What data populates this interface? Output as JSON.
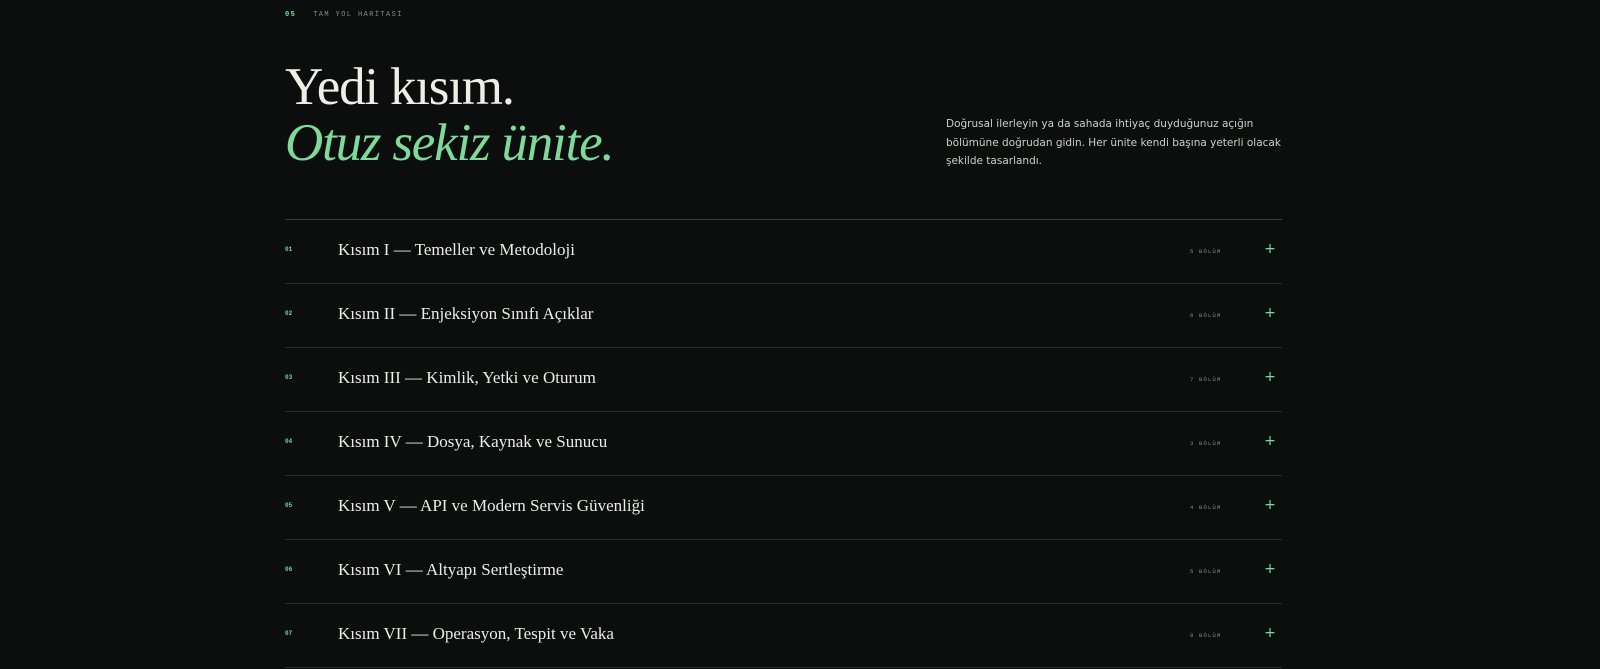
{
  "section": {
    "number": "05",
    "label": "TAM YOL HARİTASI"
  },
  "headline": {
    "line1": "Yedi kısım.",
    "line2": "Otuz sekiz ünite."
  },
  "intro": "Doğrusal ilerleyin ya da sahada ihtiyaç duyduğunuz açığın bölümüne doğrudan gidin. Her ünite kendi başına yeterli olacak şekilde tasarlandı.",
  "parts": [
    {
      "num": "01",
      "title": "Kısım I — Temeller ve Metodoloji",
      "count": "5 BÖLÜM",
      "toggle": "+"
    },
    {
      "num": "02",
      "title": "Kısım II — Enjeksiyon Sınıfı Açıklar",
      "count": "6 BÖLÜM",
      "toggle": "+"
    },
    {
      "num": "03",
      "title": "Kısım III — Kimlik, Yetki ve Oturum",
      "count": "7 BÖLÜM",
      "toggle": "+"
    },
    {
      "num": "04",
      "title": "Kısım IV — Dosya, Kaynak ve Sunucu",
      "count": "3 BÖLÜM",
      "toggle": "+"
    },
    {
      "num": "05",
      "title": "Kısım V — API ve Modern Servis Güvenliği",
      "count": "4 BÖLÜM",
      "toggle": "+"
    },
    {
      "num": "06",
      "title": "Kısım VI — Altyapı Sertleştirme",
      "count": "5 BÖLÜM",
      "toggle": "+"
    },
    {
      "num": "07",
      "title": "Kısım VII — Operasyon, Tespit ve Vaka",
      "count": "8 BÖLÜM",
      "toggle": "+"
    }
  ],
  "colors": {
    "background": "#0c0d0d",
    "accent": "#7fd99a",
    "text": "#ecebe4",
    "muted": "#8a8c88",
    "divider": "#2a2c2b"
  },
  "icons": {
    "expand": "plus-icon"
  }
}
